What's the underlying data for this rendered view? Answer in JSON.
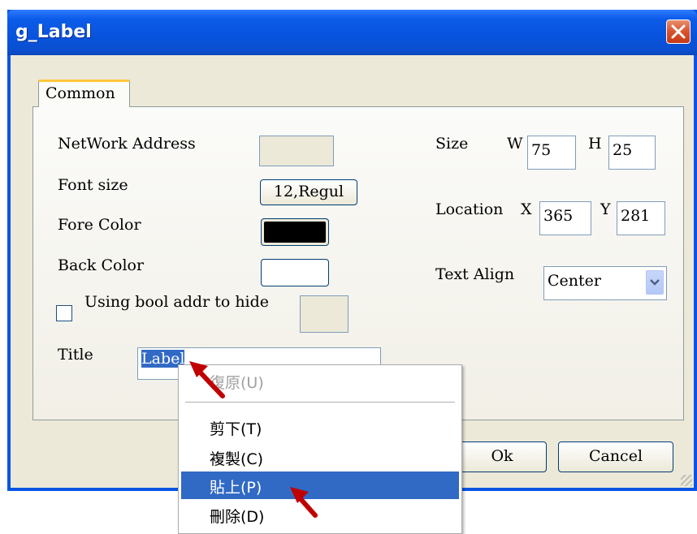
{
  "window": {
    "title": "g_Label",
    "close_glyph": "✕"
  },
  "tabs": [
    {
      "label": "Common",
      "active": true
    }
  ],
  "fields": {
    "network_address_label": "NetWork Address",
    "font_size_label": "Font size",
    "font_size_button": "12,Regul",
    "fore_color_label": "Fore Color",
    "fore_color_value": "#000000",
    "back_color_label": "Back Color",
    "back_color_value": "#ffffff",
    "bool_hide_label": "Using bool addr to hide",
    "bool_hide_checked": false,
    "title_label": "Title",
    "title_value": "Label",
    "size_label": "Size",
    "width_label": "W",
    "width_value": "75",
    "height_label": "H",
    "height_value": "25",
    "location_label": "Location",
    "x_label": "X",
    "x_value": "365",
    "y_label": "Y",
    "y_value": "281",
    "text_align_label": "Text Align",
    "text_align_value": "Center"
  },
  "buttons": {
    "ok": "Ok",
    "cancel": "Cancel"
  },
  "context_menu": {
    "items": [
      {
        "label": "復原(U)",
        "enabled": false,
        "highlighted": false
      },
      {
        "label": "剪下(T)",
        "enabled": true,
        "highlighted": false
      },
      {
        "label": "複製(C)",
        "enabled": true,
        "highlighted": false
      },
      {
        "label": "貼上(P)",
        "enabled": true,
        "highlighted": true
      },
      {
        "label": "刪除(D)",
        "enabled": true,
        "highlighted": false
      }
    ]
  },
  "annotations": {
    "arrow_color": "#c00000"
  },
  "icons": [
    "close-icon",
    "dropdown-arrow-icon",
    "annotation-arrow-icon"
  ]
}
